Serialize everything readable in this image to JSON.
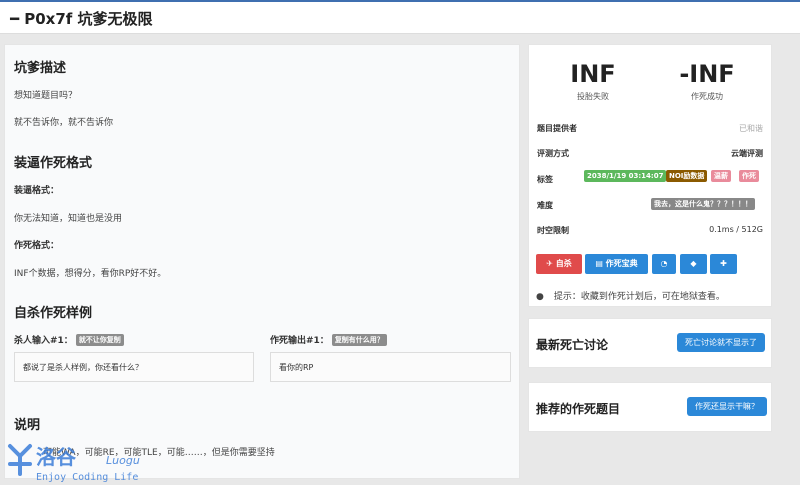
{
  "header": {
    "title": "━ P0x7f 坑爹无极限"
  },
  "problem": {
    "desc_title": "坑爹描述",
    "desc_line1": "想知道题目吗？",
    "desc_line2": "就不告诉你，就不告诉你",
    "format_title": "装逼作死格式",
    "input_label": "装逼格式：",
    "input_text": "你无法知道，知道也是没用",
    "output_label": "作死格式：",
    "output_text": "INF个数据，想得分，看你RP好不好。",
    "sample_title": "自杀作死样例",
    "sample_in_label": "杀人输入#1：",
    "sample_in_tip": "就不让你复制",
    "sample_in_text": "都说了是杀人样例，你还看什么？",
    "sample_out_label": "作死输出#1：",
    "sample_out_tip": "复制有什么用？",
    "sample_out_text": "看你的RP",
    "note_title": "说明",
    "note_text": "可能WA，可能RE，可能TLE，可能……，但是你需要坚持"
  },
  "stats": {
    "submit_value": "INF",
    "submit_label": "投胎失败",
    "ac_value": "-INF",
    "ac_label": "作死成功"
  },
  "info": {
    "provider_label": "题目提供者",
    "provider_value": "已和谐",
    "judge_label": "评测方式",
    "judge_value": "云端评测",
    "tags_label": "标签",
    "tags": [
      {
        "text": "2038/1/19 03:14:07",
        "color": "#5cb85c"
      },
      {
        "text": "NOI励数据",
        "color": "#8b5a00"
      },
      {
        "text": "温薪",
        "color": "#e98b9b"
      },
      {
        "text": "作死",
        "color": "#e98b9b"
      }
    ],
    "difficulty_label": "难度",
    "difficulty_value": "我去，这是什么鬼？？？！！！",
    "difficulty_color": "#888888",
    "limit_label": "时空限制",
    "limit_value": "0.1ms / 512G"
  },
  "actions": {
    "suicide_label": "✈ 自杀",
    "book_label": "▤ 作死宝典",
    "accent_red": "#e04b4b",
    "accent_blue": "#2b88d8"
  },
  "hint": "提示：收藏到作死计划后，可在地狱查看。",
  "discussion": {
    "title": "最新死亡讨论",
    "button": "死亡讨论就不显示了"
  },
  "recommend": {
    "title": "推荐的作死题目",
    "button": "作死还显示干嘛？"
  },
  "logo": {
    "cn": "洛谷",
    "en": "Luogu",
    "slogan": "Enjoy Coding Life"
  }
}
